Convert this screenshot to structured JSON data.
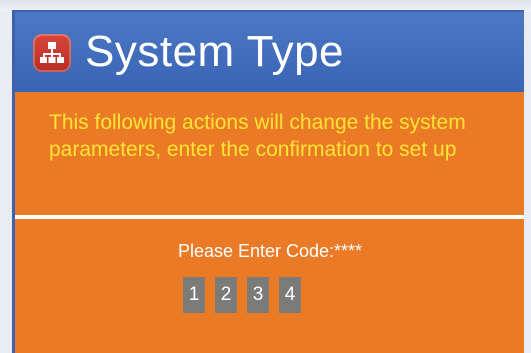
{
  "dialog": {
    "title": "System Type",
    "icon": "network-hierarchy-icon",
    "message": "This following actions will change the system parameters, enter the confirmation to set up",
    "prompt": "Please Enter Code:****",
    "keys": [
      "1",
      "2",
      "3",
      "4"
    ]
  },
  "colors": {
    "header_blue": "#3c61ad",
    "body_orange": "#ea7a26",
    "message_yellow": "#ffe433",
    "key_gray": "#7b7b79",
    "icon_red": "#c6352c"
  }
}
